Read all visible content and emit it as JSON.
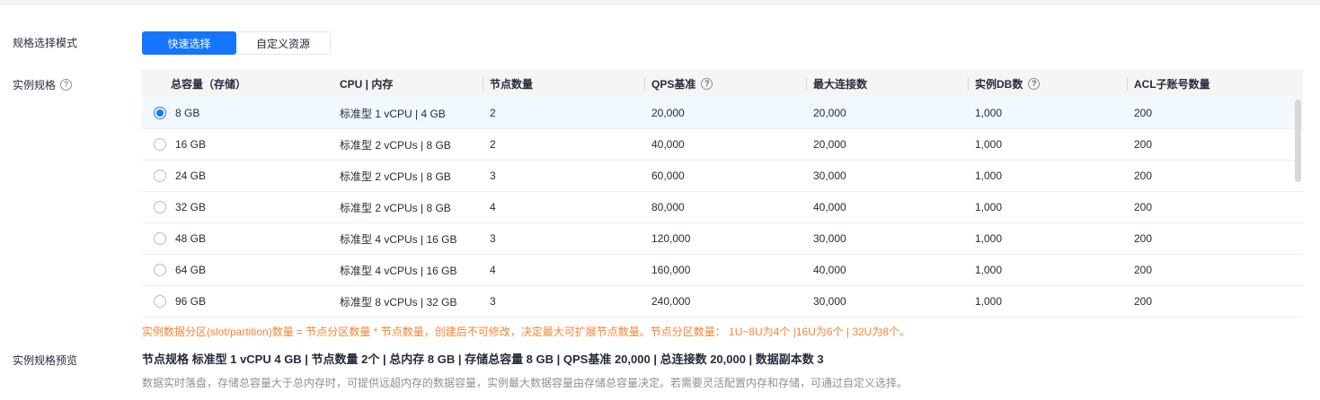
{
  "labels": {
    "mode": "规格选择模式",
    "spec": "实例规格",
    "preview": "实例规格预览"
  },
  "tabs": [
    {
      "label": "快速选择",
      "active": true
    },
    {
      "label": "自定义资源",
      "active": false
    }
  ],
  "table": {
    "columns": [
      {
        "label": "总容量（存储）",
        "help": false
      },
      {
        "label": "CPU | 内存",
        "help": false
      },
      {
        "label": "节点数量",
        "help": false
      },
      {
        "label": "QPS基准",
        "help": true
      },
      {
        "label": "最大连接数",
        "help": false
      },
      {
        "label": "实例DB数",
        "help": true
      },
      {
        "label": "ACL子账号数量",
        "help": false
      }
    ],
    "rows": [
      {
        "capacity": "8 GB",
        "cpu_mem": "标准型 1 vCPU | 4 GB",
        "nodes": "2",
        "qps": "20,000",
        "max_conn": "20,000",
        "db_count": "1,000",
        "acl": "200",
        "selected": true
      },
      {
        "capacity": "16 GB",
        "cpu_mem": "标准型 2 vCPUs | 8 GB",
        "nodes": "2",
        "qps": "40,000",
        "max_conn": "20,000",
        "db_count": "1,000",
        "acl": "200",
        "selected": false
      },
      {
        "capacity": "24 GB",
        "cpu_mem": "标准型 2 vCPUs | 8 GB",
        "nodes": "3",
        "qps": "60,000",
        "max_conn": "30,000",
        "db_count": "1,000",
        "acl": "200",
        "selected": false
      },
      {
        "capacity": "32 GB",
        "cpu_mem": "标准型 2 vCPUs | 8 GB",
        "nodes": "4",
        "qps": "80,000",
        "max_conn": "40,000",
        "db_count": "1,000",
        "acl": "200",
        "selected": false
      },
      {
        "capacity": "48 GB",
        "cpu_mem": "标准型 4 vCPUs | 16 GB",
        "nodes": "3",
        "qps": "120,000",
        "max_conn": "30,000",
        "db_count": "1,000",
        "acl": "200",
        "selected": false
      },
      {
        "capacity": "64 GB",
        "cpu_mem": "标准型 4 vCPUs | 16 GB",
        "nodes": "4",
        "qps": "160,000",
        "max_conn": "40,000",
        "db_count": "1,000",
        "acl": "200",
        "selected": false
      },
      {
        "capacity": "96 GB",
        "cpu_mem": "标准型 8 vCPUs | 32 GB",
        "nodes": "3",
        "qps": "240,000",
        "max_conn": "30,000",
        "db_count": "1,000",
        "acl": "200",
        "selected": false
      }
    ],
    "note": "实例数据分区(slot/partition)数量 = 节点分区数量 * 节点数量，创建后不可修改，决定最大可扩展节点数量。节点分区数量： 1U~8U为4个 |16U为6个 | 32U为8个。"
  },
  "preview": {
    "summary": "节点规格 标准型 1 vCPU 4 GB | 节点数量 2个 | 总内存 8 GB | 存储总容量 8 GB | QPS基准 20,000 | 总连接数 20,000 | 数据副本数 3",
    "description": "数据实时落盘，存储总容量大于总内存时，可提供远超内存的数据容量，实例最大数据容量由存储总容量决定。若需要灵活配置内存和存储，可通过自定义选择。"
  },
  "colors": {
    "accent": "#1476ff",
    "warning": "#fa8334",
    "selected_row_bg": "#f2f8ff",
    "header_bg": "#f5f5f5"
  }
}
